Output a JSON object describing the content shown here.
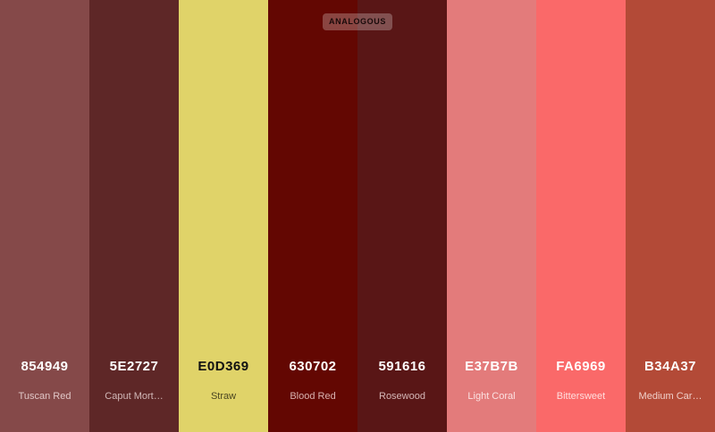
{
  "tag_label": "ANALOGOUS",
  "swatches": [
    {
      "hex": "854949",
      "name": "Tuscan Red",
      "color": "#854949",
      "text": "#ffffff",
      "sub": "#e0c6c6"
    },
    {
      "hex": "5E2727",
      "name": "Caput Mort…",
      "color": "#5E2727",
      "text": "#ffffff",
      "sub": "#d2b8b8"
    },
    {
      "hex": "E0D369",
      "name": "Straw",
      "color": "#E0D369",
      "text": "#111111",
      "sub": "#4a4520"
    },
    {
      "hex": "630702",
      "name": "Blood Red",
      "color": "#630702",
      "text": "#ffffff",
      "sub": "#d8b2b0"
    },
    {
      "hex": "591616",
      "name": "Rosewood",
      "color": "#591616",
      "text": "#ffffff",
      "sub": "#d5b7b7"
    },
    {
      "hex": "E37B7B",
      "name": "Light Coral",
      "color": "#E37B7B",
      "text": "#ffffff",
      "sub": "#fbe1e1"
    },
    {
      "hex": "FA6969",
      "name": "Bittersweet",
      "color": "#FA6969",
      "text": "#ffffff",
      "sub": "#ffdede"
    },
    {
      "hex": "B34A37",
      "name": "Medium Car…",
      "color": "#B34A37",
      "text": "#ffffff",
      "sub": "#f0d0ca"
    }
  ]
}
